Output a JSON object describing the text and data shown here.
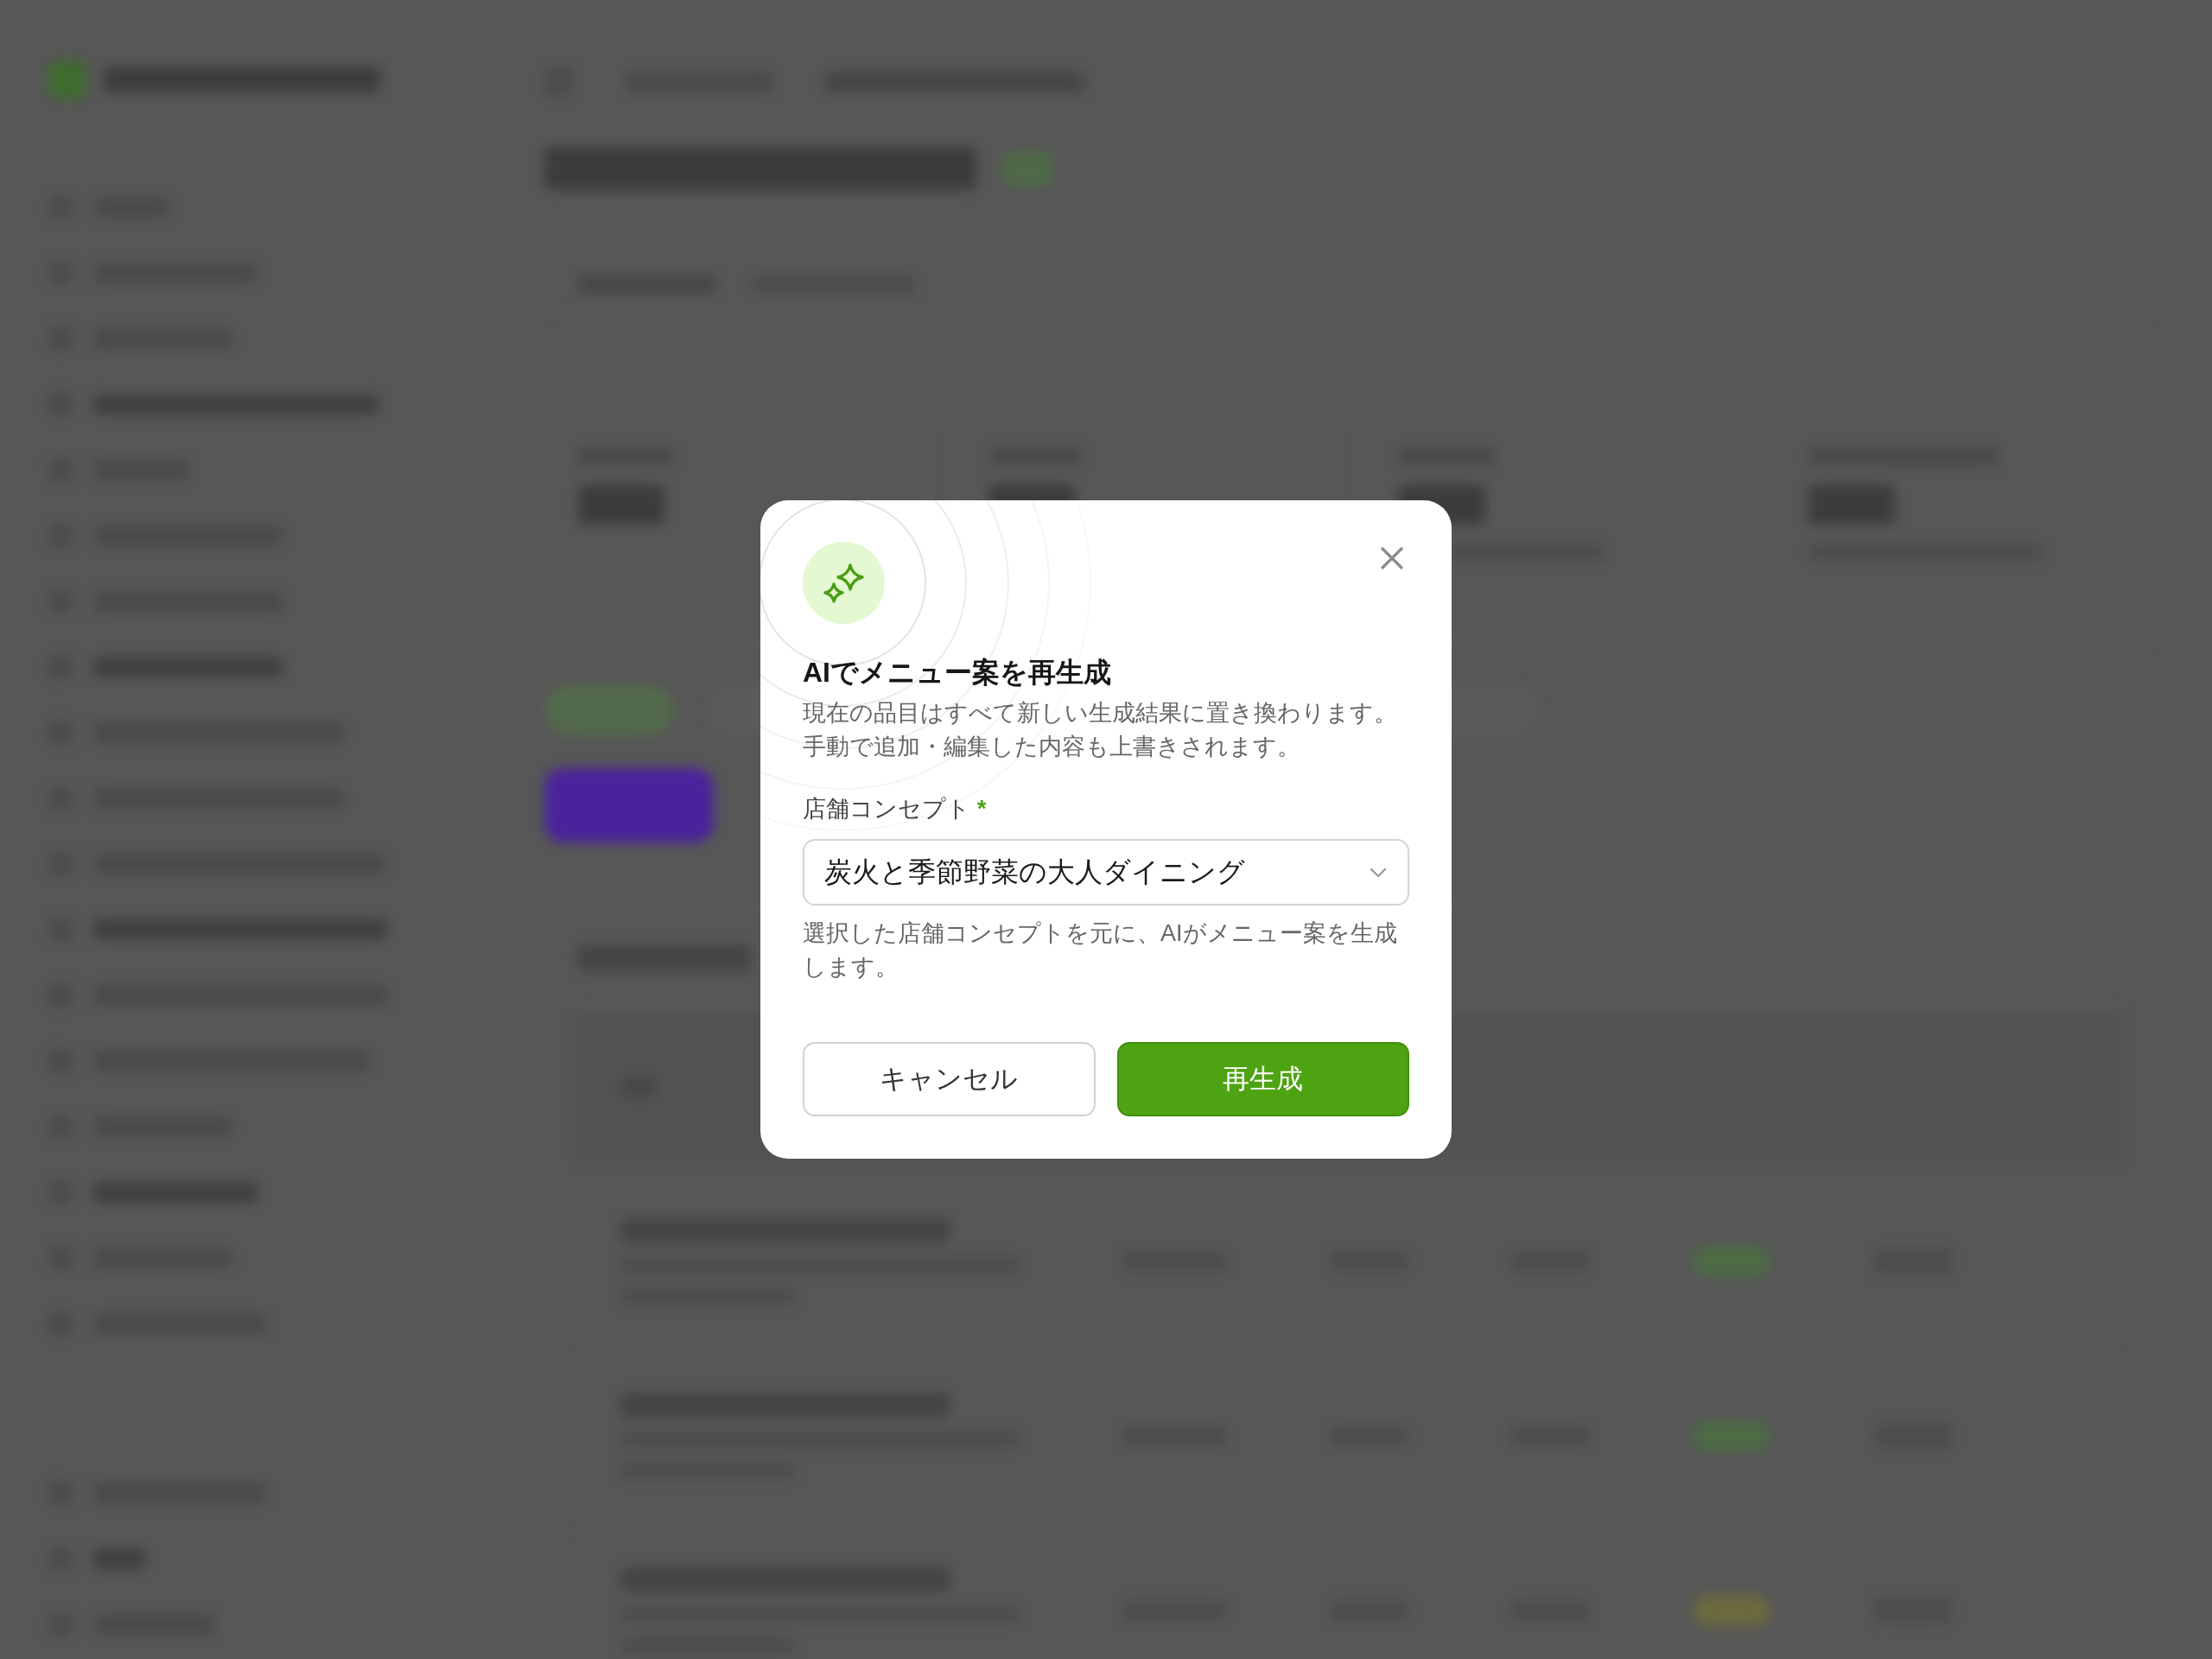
{
  "dialog": {
    "title": "AIでメニュー案を再生成",
    "description": [
      "現在の品目はすべて新しい生成結果に置き換わります。",
      "手動で追加・編集した内容も上書きされます。"
    ],
    "field": {
      "label": "店舗コンセプト",
      "required_mark": "*",
      "value": "炭火と季節野菜の大人ダイニング",
      "help": [
        "選択した店舗コンセプトを元に、AIがメニュー案を生成",
        "します。"
      ]
    },
    "buttons": [
      {
        "label": "キャンセル",
        "kind": "secondary"
      },
      {
        "label": "再生成",
        "kind": "primary"
      }
    ]
  }
}
